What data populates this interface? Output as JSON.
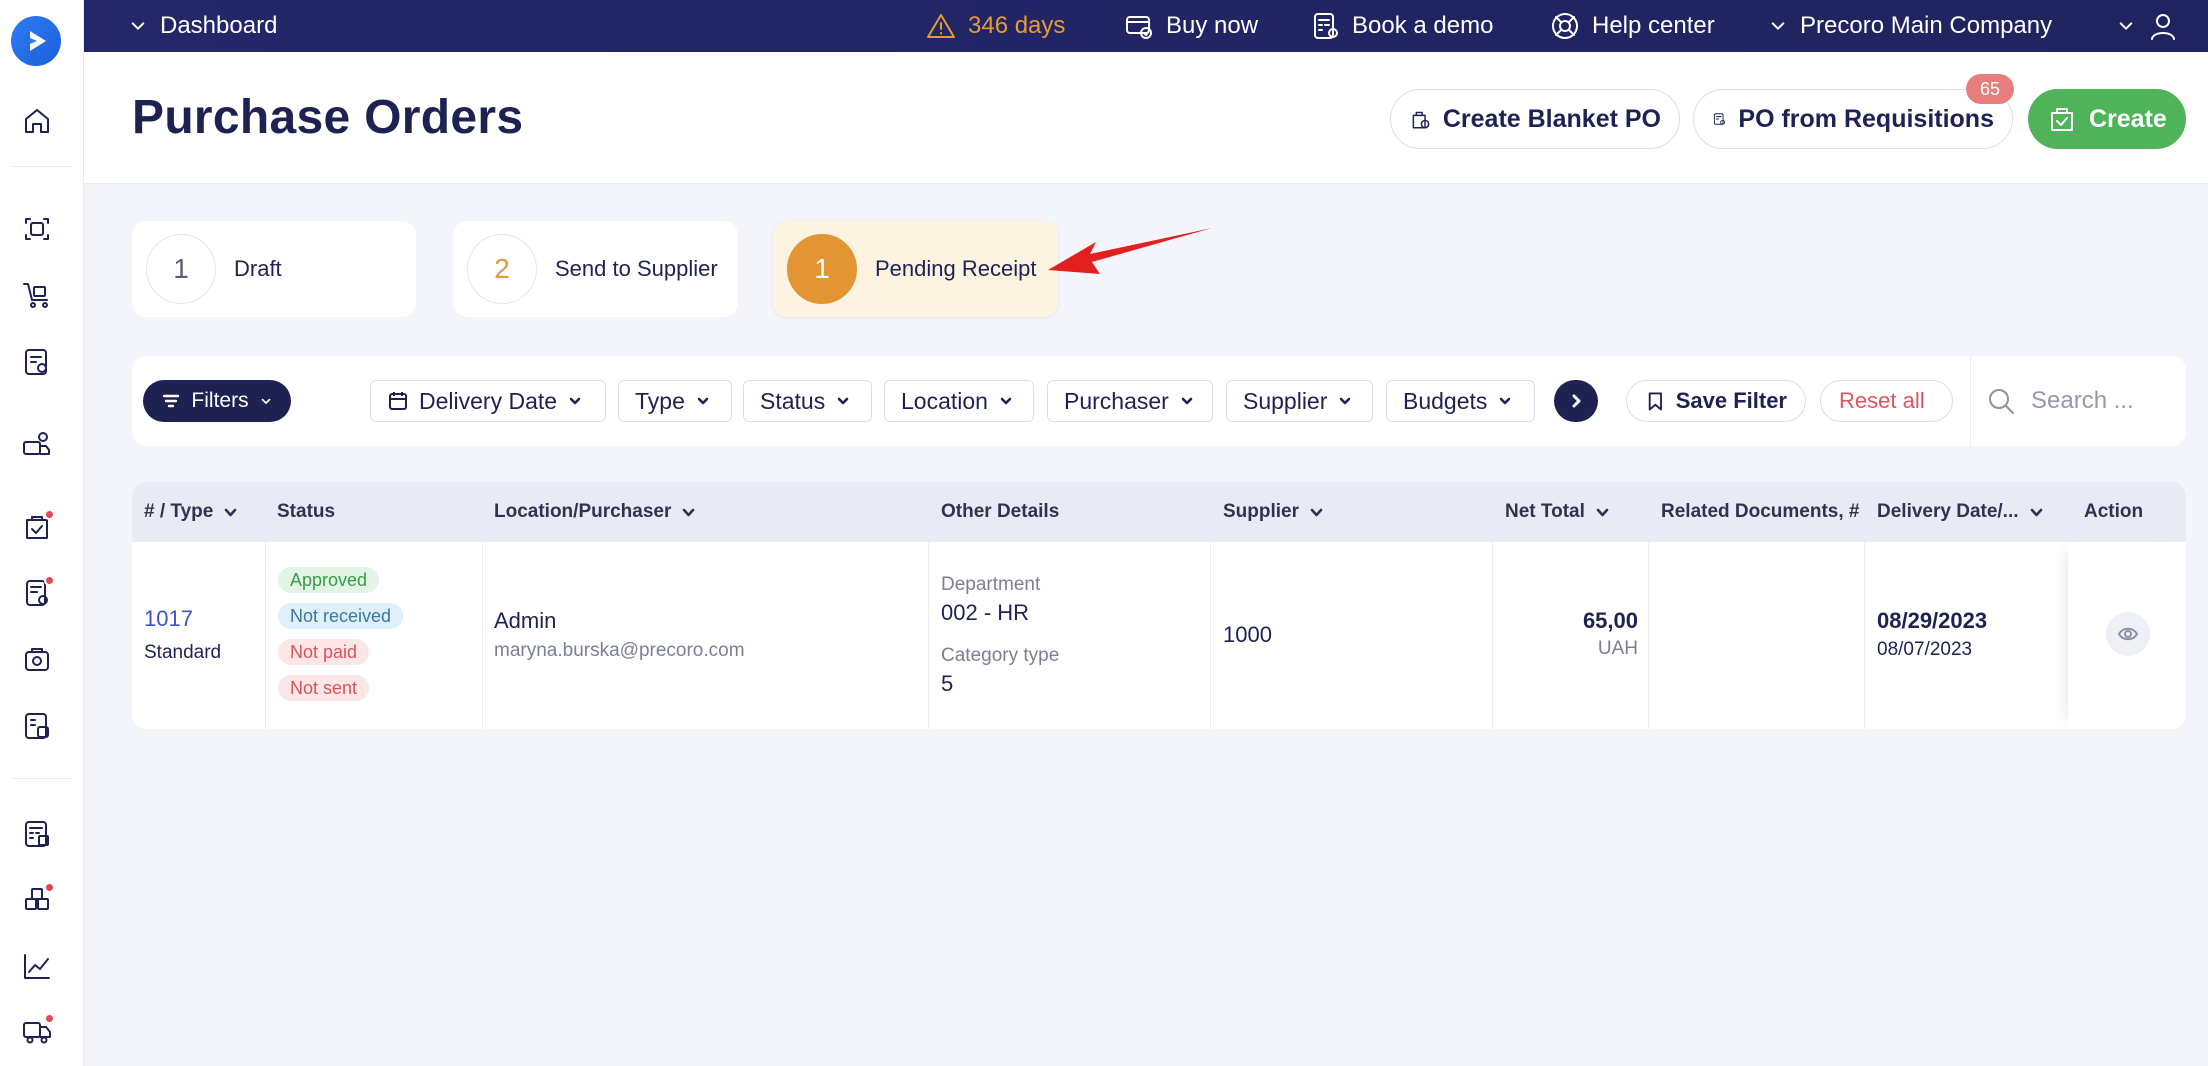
{
  "topbar": {
    "dashboard": "Dashboard",
    "trial": "346 days",
    "buy_now": "Buy now",
    "book_demo": "Book a demo",
    "help_center": "Help center",
    "company": "Precoro Main Company"
  },
  "header": {
    "title": "Purchase Orders",
    "create_blanket": "Create Blanket PO",
    "po_from_requisitions": "PO from Requisitions",
    "requisitions_badge": "65",
    "create": "Create"
  },
  "status_cards": [
    {
      "count": "1",
      "label": "Draft"
    },
    {
      "count": "2",
      "label": "Send to Supplier"
    },
    {
      "count": "1",
      "label": "Pending Receipt"
    }
  ],
  "filters": {
    "filters_label": "Filters",
    "chips": [
      "Delivery Date",
      "Type",
      "Status",
      "Location",
      "Purchaser",
      "Supplier",
      "Budgets"
    ],
    "save_filter": "Save Filter",
    "reset_all": "Reset all",
    "search_placeholder": "Search ..."
  },
  "table": {
    "columns": [
      "# / Type",
      "Status",
      "Location/Purchaser",
      "Other Details",
      "Supplier",
      "Net Total",
      "Related Documents, #",
      "Delivery Date/...",
      "Action"
    ],
    "rows": [
      {
        "number": "1017",
        "type": "Standard",
        "statuses": [
          "Approved",
          "Not received",
          "Not paid",
          "Not sent"
        ],
        "purchaser": "Admin",
        "email": "maryna.burska@precoro.com",
        "dept_label": "Department",
        "dept_value": "002 - HR",
        "cat_label": "Category type",
        "cat_value": "5",
        "supplier": "1000",
        "net_total": "65,00",
        "currency": "UAH",
        "delivery_date": "08/29/2023",
        "created_date": "08/07/2023"
      }
    ]
  },
  "colors": {
    "navy": "#1e2252",
    "orange": "#e39433",
    "green": "#4fb35a",
    "red_dot": "#e8464f",
    "link_blue": "#3c54c9"
  }
}
